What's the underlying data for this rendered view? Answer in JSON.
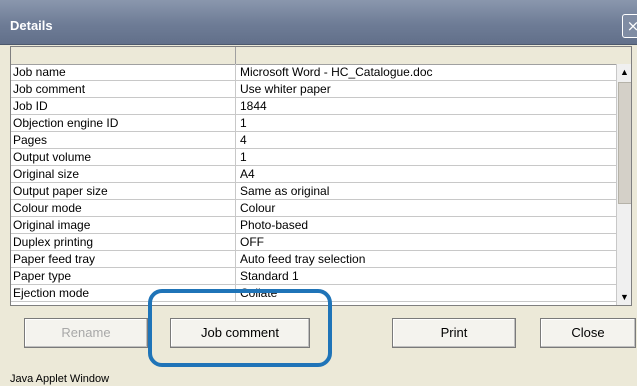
{
  "window": {
    "title": "Details",
    "close_glyph": "×"
  },
  "table": {
    "rows": [
      {
        "key": "Job name",
        "value": "Microsoft Word - HC_Catalogue.doc"
      },
      {
        "key": "Job comment",
        "value": "Use whiter paper"
      },
      {
        "key": "Job ID",
        "value": "1844"
      },
      {
        "key": "Objection engine ID",
        "value": "1"
      },
      {
        "key": "Pages",
        "value": "4"
      },
      {
        "key": "Output volume",
        "value": "1"
      },
      {
        "key": "Original size",
        "value": "A4"
      },
      {
        "key": "Output paper size",
        "value": "Same as original"
      },
      {
        "key": "Colour mode",
        "value": "Colour"
      },
      {
        "key": "Original image",
        "value": "Photo-based"
      },
      {
        "key": "Duplex printing",
        "value": "OFF"
      },
      {
        "key": "Paper feed tray",
        "value": "Auto feed tray selection"
      },
      {
        "key": "Paper type",
        "value": "Standard 1"
      },
      {
        "key": "Ejection mode",
        "value": "Collate"
      }
    ],
    "scroll_up_glyph": "▲",
    "scroll_down_glyph": "▼"
  },
  "buttons": {
    "rename": "Rename",
    "job_comment": "Job comment",
    "print": "Print",
    "close": "Close"
  },
  "footer": {
    "applet_label": "Java Applet Window"
  },
  "colors": {
    "highlight": "#1f74b8",
    "titlebar": "#6e7c96"
  }
}
